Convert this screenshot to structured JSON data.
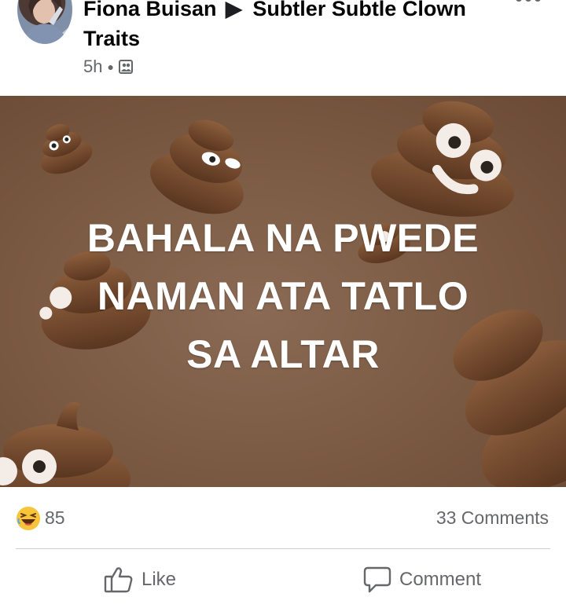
{
  "post": {
    "author": "Fiona Buisan",
    "group": "Subtler Subtle Clown Traits",
    "time": "5h",
    "audience_icon": "group-audience-icon"
  },
  "image": {
    "caption_lines": [
      "BAHALA NA PWEDE",
      "NAMAN ATA TATLO",
      "SA ALTAR"
    ],
    "background_color": "#7d5c45"
  },
  "stats": {
    "reaction_emoji": "laughing-face-icon",
    "reaction_count": "85",
    "comments": "33 Comments"
  },
  "actions": {
    "like_label": "Like",
    "comment_label": "Comment"
  },
  "colors": {
    "muted_text": "#65676b",
    "divider": "#ced0d4"
  }
}
